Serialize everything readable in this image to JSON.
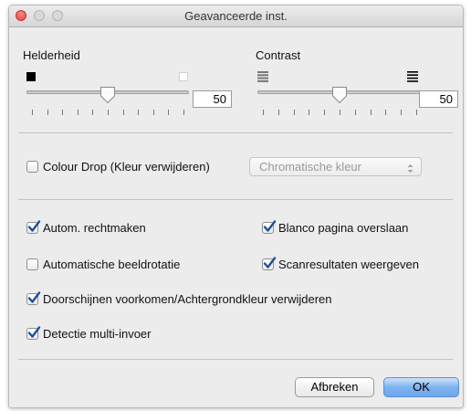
{
  "window": {
    "title": "Geavanceerde inst."
  },
  "brightness": {
    "label": "Helderheid",
    "value": "50",
    "level": 0.5
  },
  "contrast": {
    "label": "Contrast",
    "value": "50",
    "level": 0.5
  },
  "colour_drop": {
    "label": "Colour Drop (Kleur verwijderen)",
    "checked": false,
    "select_value": "Chromatische kleur"
  },
  "options": {
    "auto_straighten": {
      "label": "Autom. rechtmaken",
      "checked": true
    },
    "skip_blank": {
      "label": "Blanco pagina overslaan",
      "checked": true
    },
    "auto_rotate": {
      "label": "Automatische beeldrotatie",
      "checked": false
    },
    "show_results": {
      "label": "Scanresultaten weergeven",
      "checked": true
    },
    "bleed_through": {
      "label": "Doorschijnen voorkomen/Achtergrondkleur verwijderen",
      "checked": true
    },
    "multifeed": {
      "label": "Detectie multi-invoer",
      "checked": true
    }
  },
  "buttons": {
    "cancel": "Afbreken",
    "ok": "OK"
  },
  "colors": {
    "accent": "#4a86d8",
    "close": "#e0443e"
  }
}
